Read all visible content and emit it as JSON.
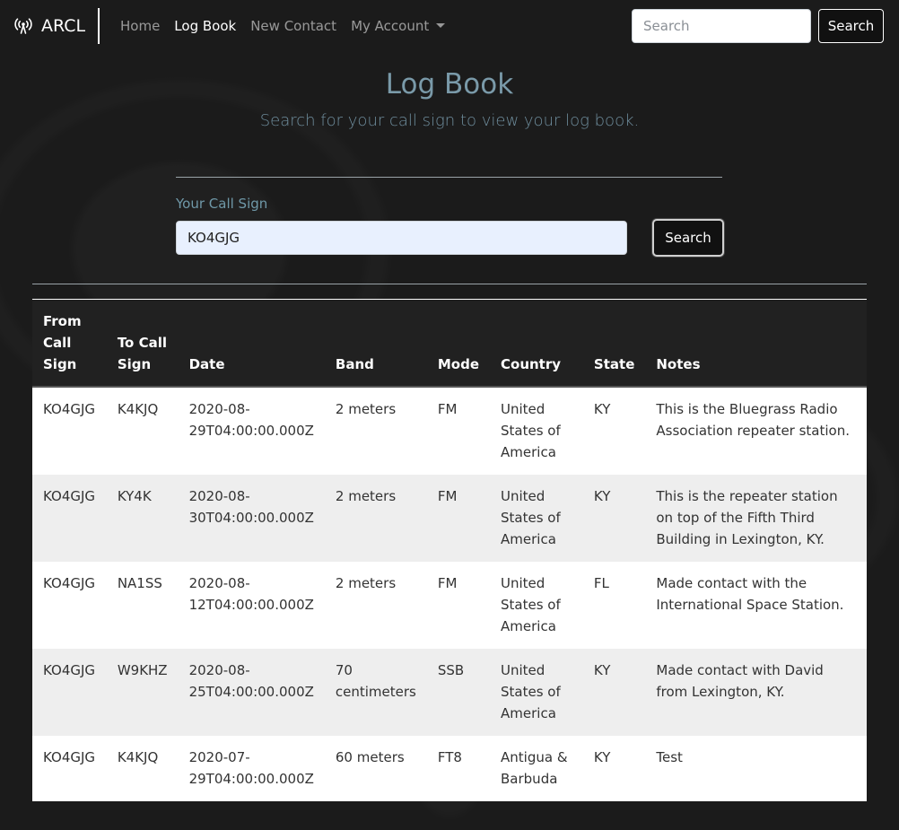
{
  "navbar": {
    "brand": "ARCL",
    "brand_icon": "radio-tower-icon",
    "links": [
      {
        "label": "Home",
        "active": false
      },
      {
        "label": "Log Book",
        "active": true
      },
      {
        "label": "New Contact",
        "active": false
      },
      {
        "label": "My Account",
        "active": false
      }
    ],
    "search_placeholder": "Search",
    "search_button": "Search"
  },
  "header": {
    "title": "Log Book",
    "subtitle": "Search for your call sign to view your log book."
  },
  "form": {
    "label": "Your Call Sign",
    "value": "KO4GJG",
    "button": "Search"
  },
  "table": {
    "headers": [
      "From Call Sign",
      "To Call Sign",
      "Date",
      "Band",
      "Mode",
      "Country",
      "State",
      "Notes"
    ],
    "rows": [
      [
        "KO4GJG",
        "K4KJQ",
        "2020-08-29T04:00:00.000Z",
        "2 meters",
        "FM",
        "United States of America",
        "KY",
        "This is the Bluegrass Radio Association repeater station."
      ],
      [
        "KO4GJG",
        "KY4K",
        "2020-08-30T04:00:00.000Z",
        "2 meters",
        "FM",
        "United States of America",
        "KY",
        "This is the repeater station on top of the Fifth Third Building in Lexington, KY."
      ],
      [
        "KO4GJG",
        "NA1SS",
        "2020-08-12T04:00:00.000Z",
        "2 meters",
        "FM",
        "United States of America",
        "FL",
        "Made contact with the International Space Station."
      ],
      [
        "KO4GJG",
        "W9KHZ",
        "2020-08-25T04:00:00.000Z",
        "70 centimeters",
        "SSB",
        "United States of America",
        "KY",
        "Made contact with David from Lexington, KY."
      ],
      [
        "KO4GJG",
        "K4KJQ",
        "2020-07-29T04:00:00.000Z",
        "60 meters",
        "FT8",
        "Antigua & Barbuda",
        "KY",
        "Test"
      ]
    ]
  },
  "colors": {
    "background": "#1b1b1b",
    "title": "#7a9aa9",
    "table_header": "#212121",
    "row_stripe": "#eeeeee"
  }
}
